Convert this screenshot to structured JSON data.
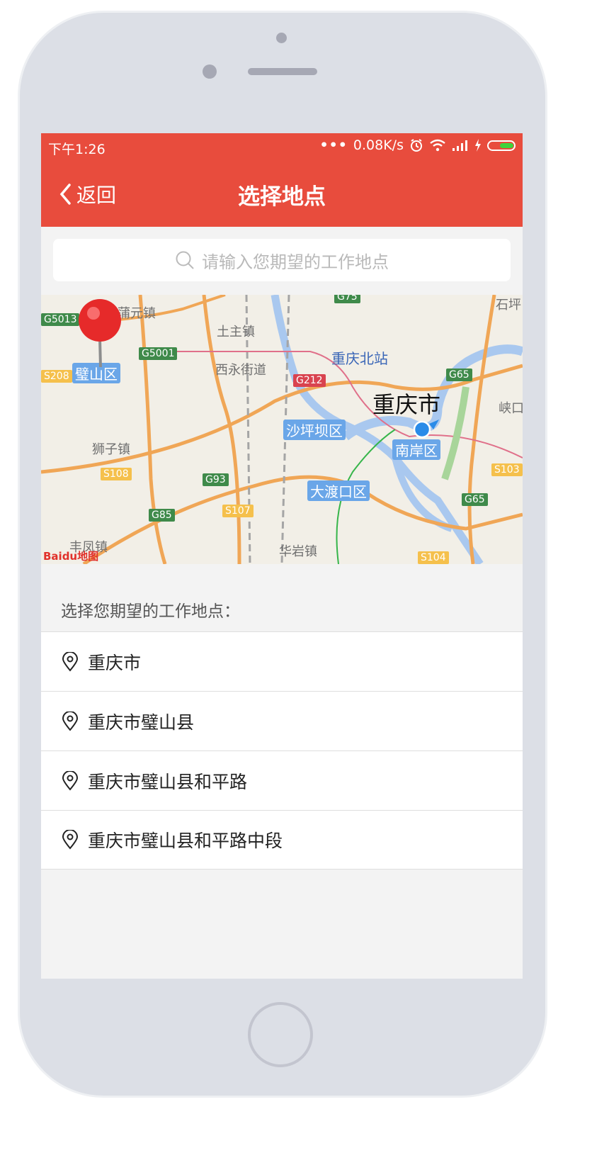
{
  "status": {
    "time": "下午1:26",
    "speed": "0.08K/s",
    "dots": "•••"
  },
  "nav": {
    "back_label": "返回",
    "title": "选择地点"
  },
  "search": {
    "placeholder": "请输入您期望的工作地点"
  },
  "map": {
    "labels": {
      "puyuan": "蒲元镇",
      "tuzhu": "土主镇",
      "xiyong": "西永街道",
      "shizi": "狮子镇",
      "huayan": "华岩镇",
      "fengzhen": "丰凤镇",
      "shiping": "石坪",
      "xia": "峡口",
      "bishan": "璧山区",
      "shapingba": "沙坪坝区",
      "nanan": "南岸区",
      "dadukou": "大渡口区",
      "station": "重庆北站",
      "city": "重庆市"
    },
    "shields": {
      "g5013": "G5013",
      "g5001": "G5001",
      "g212": "G212",
      "g75": "G75",
      "g65a": "G65",
      "g65b": "G65",
      "g93": "G93",
      "g85": "G85",
      "s208": "S208",
      "s108": "S108",
      "s107": "S107",
      "s103": "S103",
      "s104": "S104"
    },
    "logo": "Baidu地图"
  },
  "section_label": "选择您期望的工作地点：",
  "locations": [
    "重庆市",
    "重庆市璧山县",
    "重庆市璧山县和平路",
    "重庆市璧山县和平路中段"
  ]
}
